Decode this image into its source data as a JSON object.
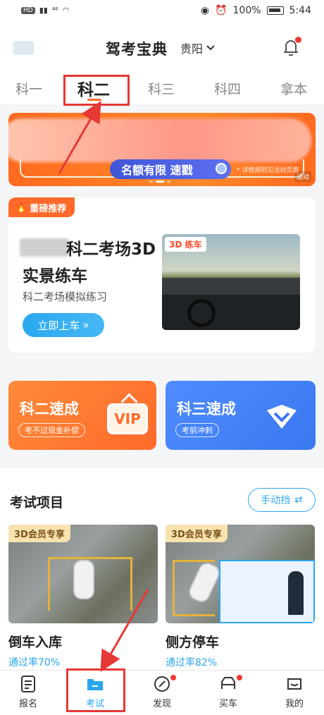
{
  "status_bar": {
    "hd": "HD",
    "signal": "⁴⁶",
    "battery_percent": "100%",
    "time": "5:44"
  },
  "header": {
    "title": "驾考宝典",
    "city": "贵阳"
  },
  "tabs": [
    "科一",
    "科二",
    "科三",
    "科四",
    "拿本"
  ],
  "active_tab_index": 1,
  "banner": {
    "pill_text": "名额有限 速戳",
    "note": "* 详情规则见活动页面",
    "tag": "活动"
  },
  "promo": {
    "hot_label": "重磅推荐",
    "title_line1": "科二考场3D",
    "title_line2": "实景练车",
    "subtitle": "科二考场模拟练习",
    "button": "立即上车",
    "badge": "3D 练车"
  },
  "quick_cards": [
    {
      "title": "科二速成",
      "sub": "考不过现金补偿",
      "badge": "VIP"
    },
    {
      "title": "科三速成",
      "sub": "考前冲刺"
    }
  ],
  "exam": {
    "title": "考试项目",
    "switch_button": "手动挡",
    "cards": [
      {
        "badge": "3D会员专享",
        "name": "倒车入库",
        "rate": "通过率70%"
      },
      {
        "badge": "3D会员专享",
        "name": "侧方停车",
        "rate": "通过率82%"
      }
    ]
  },
  "bottom_nav": [
    {
      "label": "报名",
      "icon": "document-icon"
    },
    {
      "label": "考试",
      "icon": "folder-icon"
    },
    {
      "label": "发现",
      "icon": "compass-icon"
    },
    {
      "label": "买车",
      "icon": "car-icon"
    },
    {
      "label": "我的",
      "icon": "profile-icon"
    }
  ],
  "colors": {
    "accent_orange": "#ff6a2a",
    "accent_blue": "#2aa6ee",
    "annotation_red": "#e53935"
  }
}
